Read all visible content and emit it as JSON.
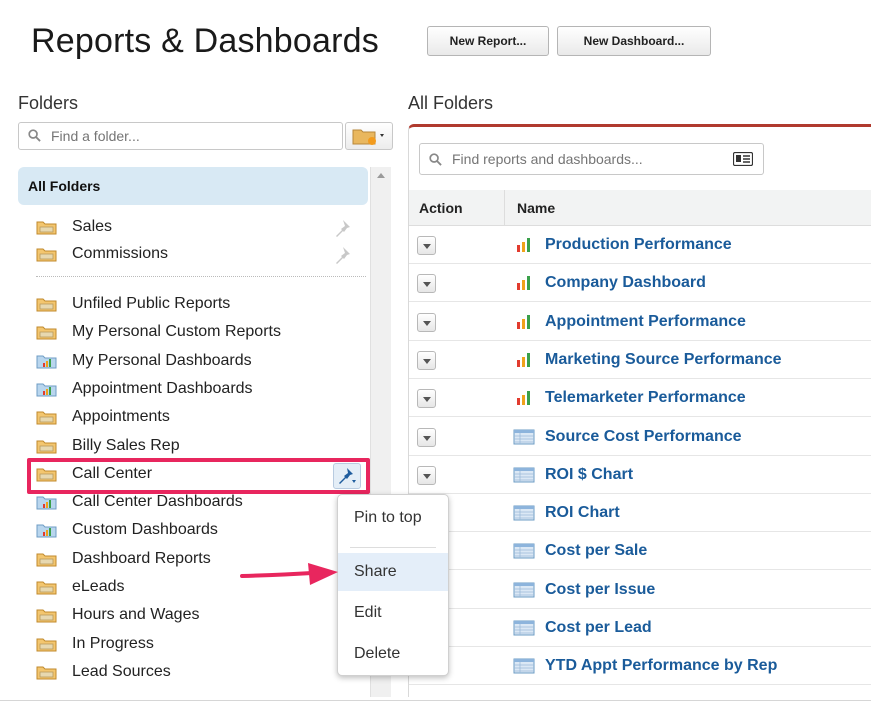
{
  "header": {
    "title": "Reports & Dashboards",
    "new_report_label": "New Report...",
    "new_dashboard_label": "New Dashboard..."
  },
  "folders_panel": {
    "heading": "Folders",
    "search_placeholder": "Find a folder...",
    "all_folders_label": "All Folders",
    "pinned": [
      {
        "label": "Sales",
        "icon": "folder-icon"
      },
      {
        "label": "Commissions",
        "icon": "folder-icon"
      }
    ],
    "items": [
      {
        "label": "Unfiled Public Reports",
        "icon": "folder-icon"
      },
      {
        "label": "My Personal Custom Reports",
        "icon": "folder-icon"
      },
      {
        "label": "My Personal Dashboards",
        "icon": "dashboard-folder-icon"
      },
      {
        "label": "Appointment Dashboards",
        "icon": "dashboard-folder-icon"
      },
      {
        "label": "Appointments",
        "icon": "folder-icon"
      },
      {
        "label": "Billy Sales Rep",
        "icon": "folder-icon"
      },
      {
        "label": "Call Center",
        "icon": "folder-icon"
      },
      {
        "label": "Call Center Dashboards",
        "icon": "dashboard-folder-icon"
      },
      {
        "label": "Custom Dashboards",
        "icon": "dashboard-folder-icon"
      },
      {
        "label": "Dashboard Reports",
        "icon": "folder-icon"
      },
      {
        "label": "eLeads",
        "icon": "folder-icon"
      },
      {
        "label": "Hours and Wages",
        "icon": "folder-icon"
      },
      {
        "label": "In Progress",
        "icon": "folder-icon"
      },
      {
        "label": "Lead Sources",
        "icon": "folder-icon"
      }
    ]
  },
  "context_menu": {
    "items": [
      "Pin to top",
      "Share",
      "Edit",
      "Delete"
    ],
    "highlighted": "Share"
  },
  "main_panel": {
    "heading": "All Folders",
    "search_placeholder": "Find reports and dashboards...",
    "columns": {
      "action": "Action",
      "name": "Name"
    },
    "rows": [
      {
        "name": "Production Performance",
        "icon": "dashboard-icon"
      },
      {
        "name": "Company Dashboard",
        "icon": "dashboard-icon"
      },
      {
        "name": "Appointment Performance",
        "icon": "dashboard-icon"
      },
      {
        "name": "Marketing Source Performance",
        "icon": "dashboard-icon"
      },
      {
        "name": "Telemarketer Performance",
        "icon": "dashboard-icon"
      },
      {
        "name": "Source Cost Performance",
        "icon": "report-icon"
      },
      {
        "name": "ROI $ Chart",
        "icon": "report-icon"
      },
      {
        "name": "ROI Chart",
        "icon": "report-icon"
      },
      {
        "name": "Cost per Sale",
        "icon": "report-icon"
      },
      {
        "name": "Cost per Issue",
        "icon": "report-icon"
      },
      {
        "name": "Cost per Lead",
        "icon": "report-icon"
      },
      {
        "name": "YTD Appt Performance by Rep",
        "icon": "report-icon"
      }
    ]
  },
  "colors": {
    "link": "#1a5b9a",
    "highlight": "#e8265e",
    "panel_accent": "#b03a2e",
    "selected_bg": "#d8e9f4"
  }
}
